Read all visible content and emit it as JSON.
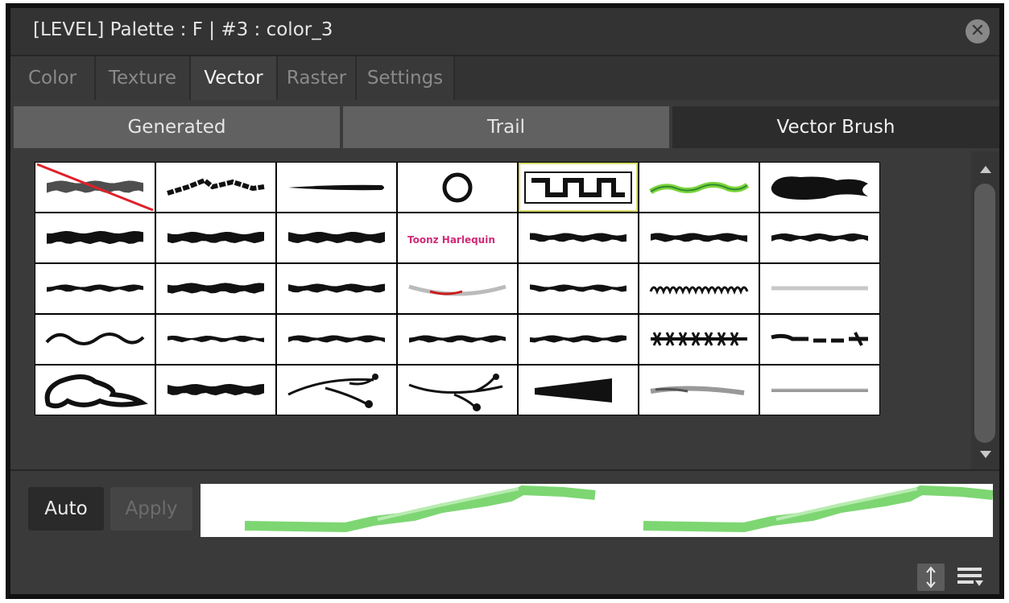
{
  "window": {
    "title": "[LEVEL]  Palette : F | #3 : color_3",
    "close_icon": "close-icon"
  },
  "tabs": [
    {
      "label": "Color",
      "active": false
    },
    {
      "label": "Texture",
      "active": false
    },
    {
      "label": "Vector",
      "active": true
    },
    {
      "label": "Raster",
      "active": false
    },
    {
      "label": "Settings",
      "active": false
    }
  ],
  "subtabs": [
    {
      "label": "Generated",
      "active": false
    },
    {
      "label": "Trail",
      "active": false
    },
    {
      "label": "Vector Brush",
      "active": true
    }
  ],
  "brush_grid": {
    "selected_index": 4,
    "cells": [
      {
        "name": "none-brush-swatch"
      },
      {
        "name": "scribble-brush-swatch"
      },
      {
        "name": "thin-taper-brush-swatch"
      },
      {
        "name": "circle-brush-swatch"
      },
      {
        "name": "square-wave-brush-swatch"
      },
      {
        "name": "green-wave-brush-swatch"
      },
      {
        "name": "blot-brush-swatch"
      },
      {
        "name": "thick-rough-brush-swatch"
      },
      {
        "name": "thick-rough-brush-2-swatch"
      },
      {
        "name": "thick-rough-brush-3-swatch"
      },
      {
        "name": "text-brush-swatch",
        "text": "Toonz Harlequin"
      },
      {
        "name": "taper-stroke-swatch"
      },
      {
        "name": "taper-stroke-2-swatch"
      },
      {
        "name": "taper-stroke-3-swatch"
      },
      {
        "name": "rough-line-swatch"
      },
      {
        "name": "bumpy-thick-swatch"
      },
      {
        "name": "smooth-thick-swatch"
      },
      {
        "name": "red-grey-swatch"
      },
      {
        "name": "medium-line-swatch"
      },
      {
        "name": "loop-brush-swatch"
      },
      {
        "name": "grey-soft-swatch"
      },
      {
        "name": "wavy-line-swatch"
      },
      {
        "name": "rough-line-2-swatch"
      },
      {
        "name": "rough-line-3-swatch"
      },
      {
        "name": "taper-rough-swatch"
      },
      {
        "name": "medium-line-2-swatch"
      },
      {
        "name": "zigzag-brush-swatch"
      },
      {
        "name": "broken-line-swatch"
      },
      {
        "name": "blob-brush-swatch"
      },
      {
        "name": "thick-rough-4-swatch"
      },
      {
        "name": "branch-brush-swatch"
      },
      {
        "name": "branch-brush-2-swatch"
      },
      {
        "name": "wedge-brush-swatch"
      },
      {
        "name": "grey-brush-swatch"
      },
      {
        "name": "grey-pencil-swatch"
      }
    ]
  },
  "bottom": {
    "auto_label": "Auto",
    "apply_label": "Apply",
    "preview_color": "#5fcf5a",
    "mode_icon": "arrows-vertical-icon",
    "menu_icon": "menu-icon"
  },
  "colors": {
    "accent_selection": "#d6dc6a",
    "panel_bg": "#3a3a3a"
  }
}
